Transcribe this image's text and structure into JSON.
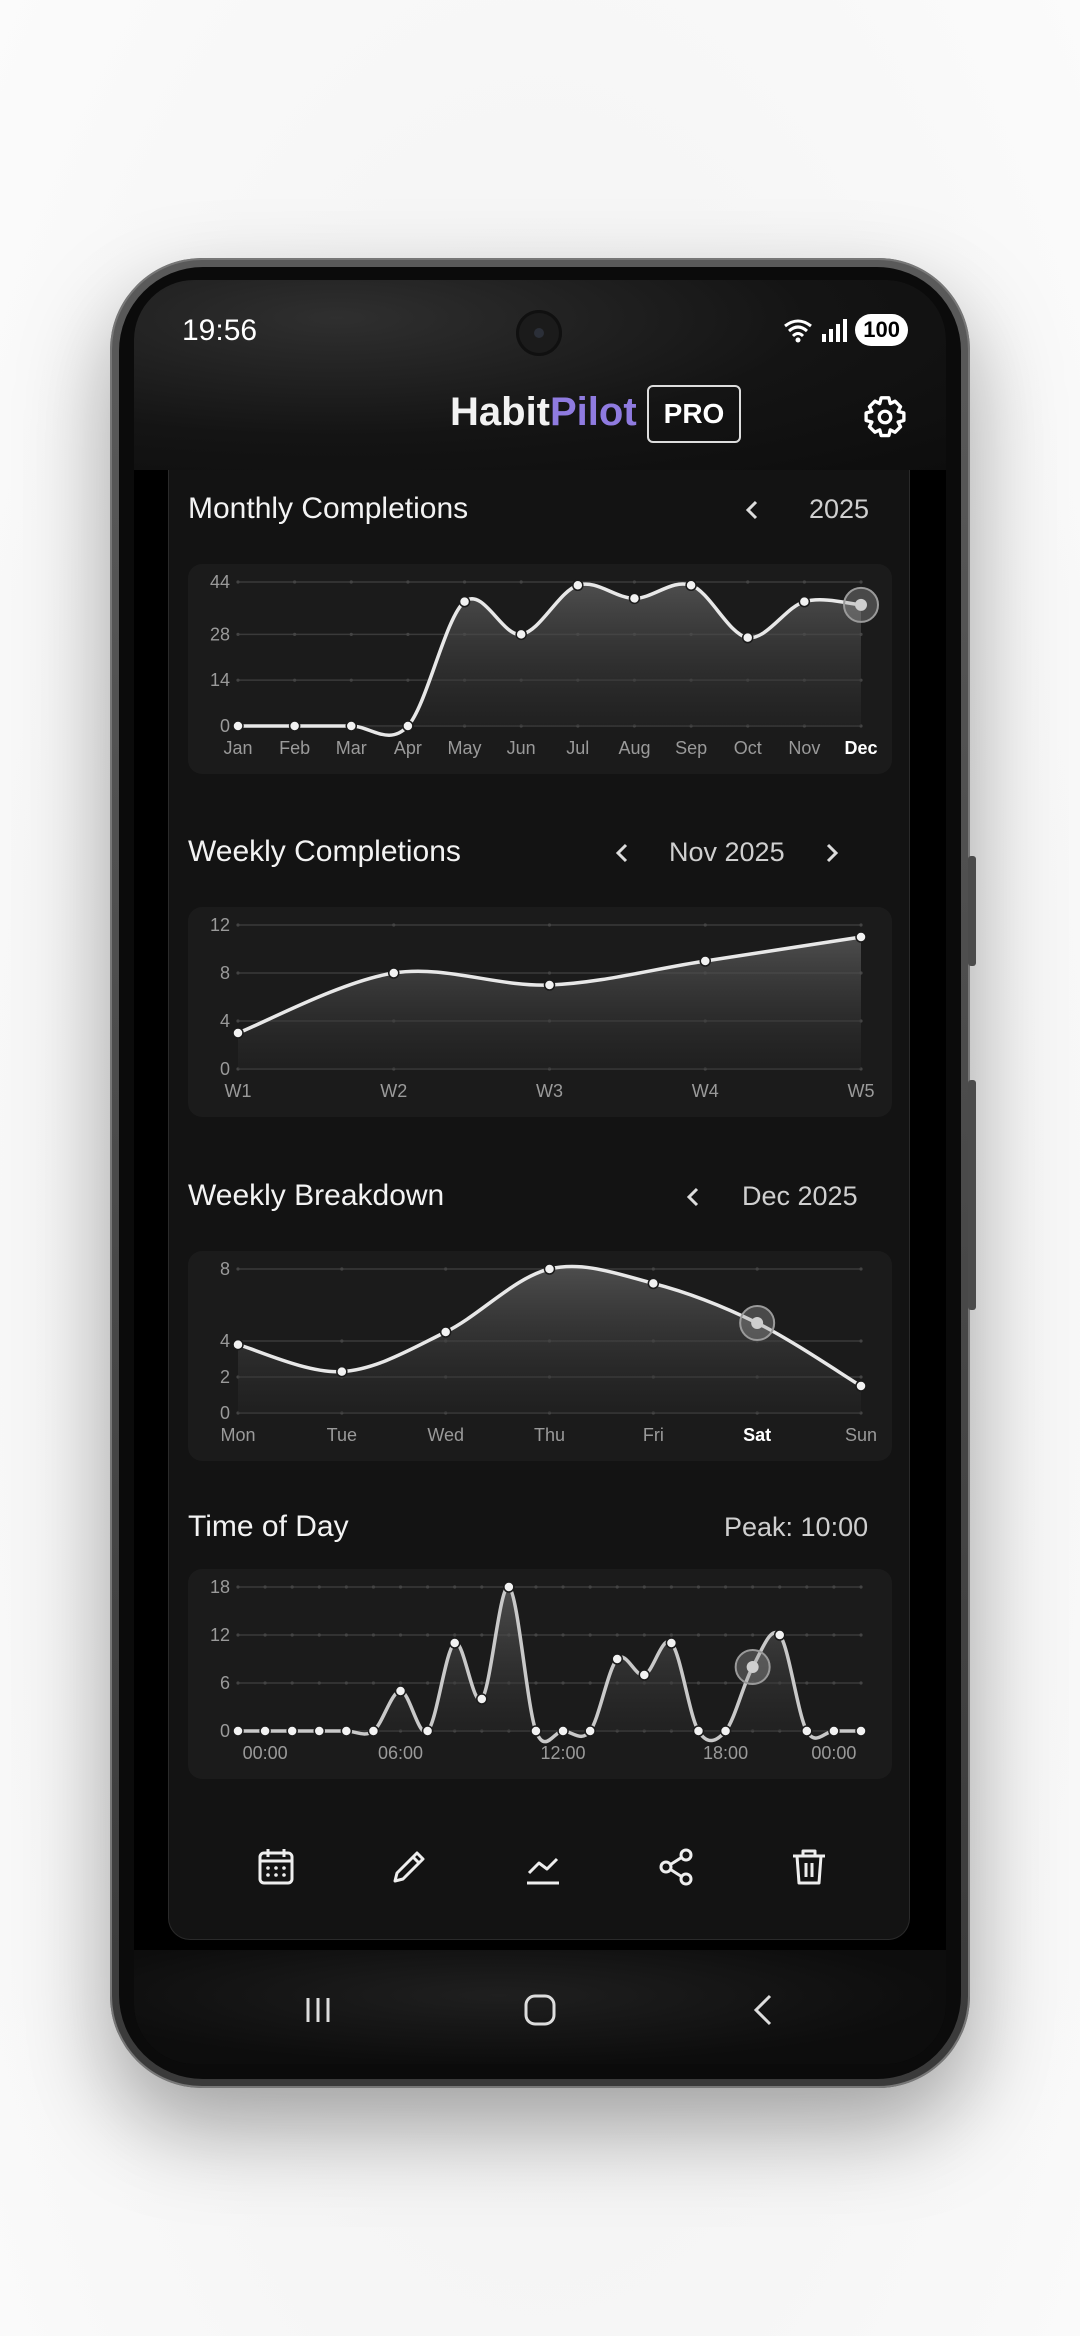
{
  "status_bar": {
    "time": "19:56",
    "battery": "100"
  },
  "header": {
    "brand_part1": "Habit",
    "brand_part2": "Pilot",
    "pro_badge": "PRO",
    "brand_accent": "#8f7be0"
  },
  "sections": {
    "monthly": {
      "title": "Monthly Completions",
      "period": "2025"
    },
    "weekly": {
      "title": "Weekly Completions",
      "period": "Nov 2025"
    },
    "breakdown": {
      "title": "Weekly Breakdown",
      "period": "Dec 2025"
    },
    "timeofday": {
      "title": "Time of Day",
      "peak": "Peak: 10:00"
    }
  },
  "chart_data": [
    {
      "type": "area",
      "id": "monthly",
      "categories": [
        "Jan",
        "Feb",
        "Mar",
        "Apr",
        "May",
        "Jun",
        "Jul",
        "Aug",
        "Sep",
        "Oct",
        "Nov",
        "Dec"
      ],
      "values": [
        0,
        0,
        0,
        0,
        38,
        28,
        43,
        39,
        43,
        27,
        38,
        37
      ],
      "yticks": [
        0,
        14,
        28,
        44
      ],
      "ylim": [
        0,
        44
      ],
      "highlight": "Dec",
      "xlabel": "",
      "ylabel": ""
    },
    {
      "type": "area",
      "id": "weekly",
      "categories": [
        "W1",
        "W2",
        "W3",
        "W4",
        "W5"
      ],
      "values": [
        3,
        8,
        7,
        9,
        11
      ],
      "yticks": [
        0,
        4,
        8,
        12
      ],
      "ylim": [
        0,
        12
      ],
      "xlabel": "",
      "ylabel": ""
    },
    {
      "type": "area",
      "id": "breakdown",
      "categories": [
        "Mon",
        "Tue",
        "Wed",
        "Thu",
        "Fri",
        "Sat",
        "Sun"
      ],
      "values": [
        3.8,
        2.3,
        4.5,
        8,
        7.2,
        5,
        1.5
      ],
      "yticks": [
        0,
        2,
        4,
        8
      ],
      "ylim": [
        0,
        8
      ],
      "highlight": "Sat",
      "xlabel": "",
      "ylabel": ""
    },
    {
      "type": "line",
      "id": "timeofday",
      "x": [
        "00:00",
        "06:00",
        "12:00",
        "18:00",
        "00:00"
      ],
      "values": [
        0,
        0,
        0,
        0,
        0,
        0,
        5,
        0,
        11,
        4,
        18,
        0,
        0,
        0,
        9,
        7,
        11,
        0,
        0,
        8,
        12,
        0,
        0,
        0
      ],
      "yticks": [
        0,
        6,
        12,
        18
      ],
      "ylim": [
        0,
        18
      ],
      "highlight_index": 19,
      "xlabel": "",
      "ylabel": ""
    }
  ],
  "toolbar": {
    "icons": [
      "calendar-icon",
      "edit-icon",
      "chart-icon",
      "share-icon",
      "delete-icon"
    ]
  },
  "navbar": {
    "icons": [
      "recent-apps-icon",
      "home-icon",
      "back-icon"
    ]
  }
}
